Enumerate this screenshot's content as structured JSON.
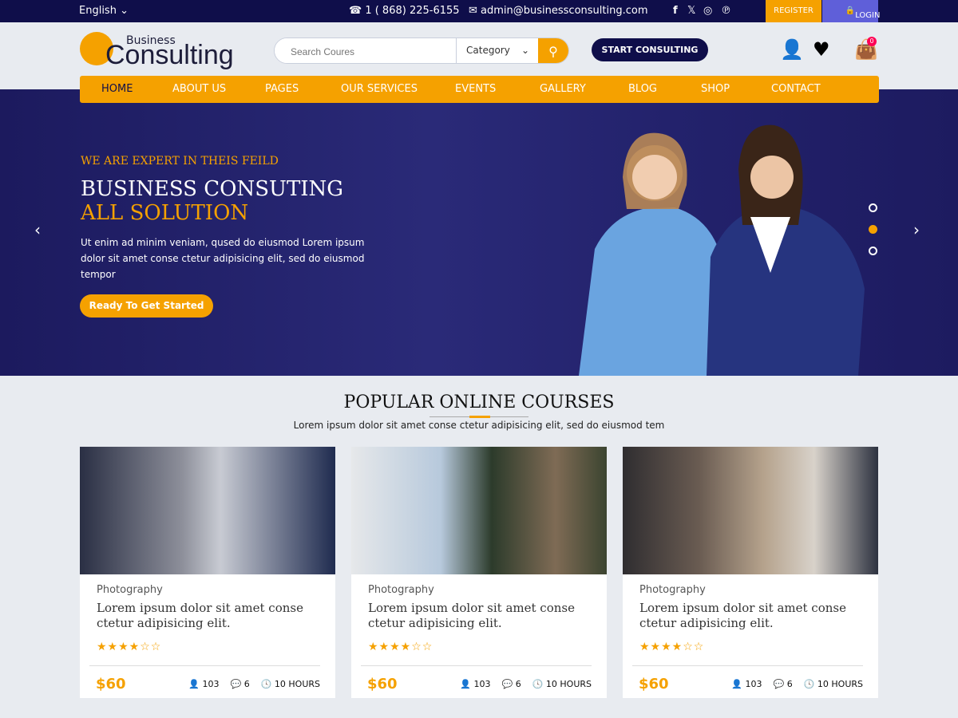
{
  "topbar": {
    "language": "English",
    "phone": "1 ( 868) 225-6155",
    "email": "admin@businessconsulting.com",
    "social": [
      "facebook-icon",
      "x-icon",
      "instagram-icon",
      "pinterest-icon"
    ],
    "register": "REGISTER",
    "login": "LOGIN"
  },
  "header": {
    "logo_top": "Business",
    "logo_main": "Consulting",
    "search_placeholder": "Search Coures",
    "category": "Category",
    "start": "START CONSULTING",
    "cart_count": "0"
  },
  "nav": [
    "HOME",
    "ABOUT US",
    "PAGES",
    "OUR SERVICES",
    "EVENTS",
    "GALLERY",
    "BLOG",
    "SHOP",
    "CONTACT"
  ],
  "hero": {
    "subtitle": "WE ARE EXPERT IN THEIS FEILD",
    "title1": "BUSINESS CONSUTING",
    "title2": "ALL SOLUTION",
    "text": "Ut enim ad minim veniam, qused do eiusmod  Lorem ipsum dolor sit amet conse ctetur adipisicing elit, sed do eiusmod tempor",
    "button": "Ready To Get Started",
    "active_slide": 2
  },
  "courses": {
    "title": "POPULAR ONLINE COURSES",
    "subtitle": "Lorem ipsum dolor sit amet conse ctetur adipisicing elit, sed do eiusmod tem",
    "items": [
      {
        "category": "Photography",
        "title": "Lorem ipsum dolor sit amet conse ctetur adipisicing elit.",
        "rating": 4,
        "stars": "★★★★☆☆",
        "price": "$60",
        "students": "103",
        "comments": "6",
        "duration": "10 HOURS"
      },
      {
        "category": "Photography",
        "title": "Lorem ipsum dolor sit amet conse ctetur adipisicing elit.",
        "rating": 4,
        "stars": "★★★★☆☆",
        "price": "$60",
        "students": "103",
        "comments": "6",
        "duration": "10 HOURS"
      },
      {
        "category": "Photography",
        "title": "Lorem ipsum dolor sit amet conse ctetur adipisicing elit.",
        "rating": 4,
        "stars": "★★★★☆☆",
        "price": "$60",
        "students": "103",
        "comments": "6",
        "duration": "10 HOURS"
      }
    ]
  },
  "colors": {
    "navy": "#0f0e4a",
    "accent": "#f5a100",
    "login": "#5f5fd9"
  }
}
